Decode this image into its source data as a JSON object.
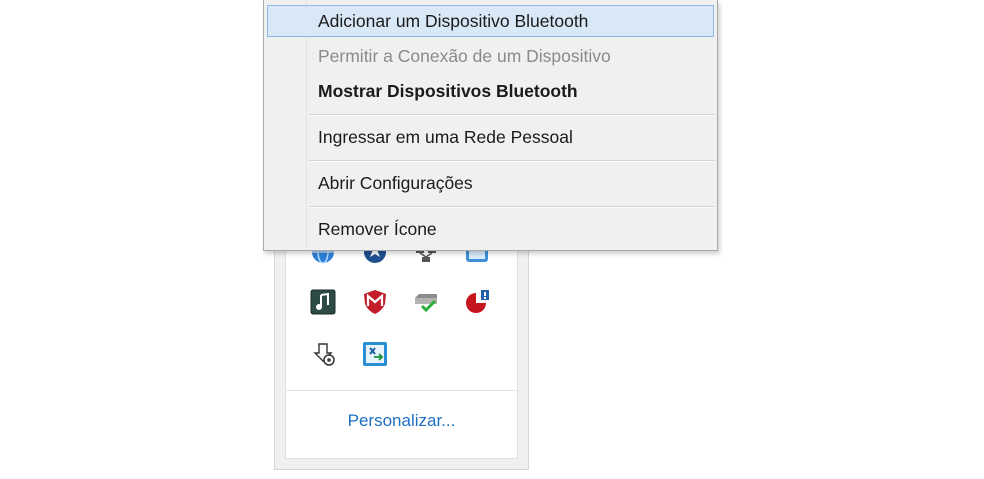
{
  "menu": {
    "items": [
      {
        "label": "Adicionar um Dispositivo Bluetooth",
        "state": "highlighted"
      },
      {
        "label": "Permitir a Conexão de um Dispositivo",
        "state": "disabled"
      },
      {
        "label": "Mostrar Dispositivos Bluetooth",
        "state": "default"
      },
      {
        "label": "Ingressar em uma Rede Pessoal",
        "state": "normal"
      },
      {
        "label": "Abrir Configurações",
        "state": "normal"
      },
      {
        "label": "Remover Ícone",
        "state": "normal"
      }
    ]
  },
  "tray": {
    "icons": [
      {
        "name": "blue-globe-icon"
      },
      {
        "name": "navigation-compass-icon"
      },
      {
        "name": "network-icon"
      },
      {
        "name": "blue-window-icon"
      },
      {
        "name": "music-player-icon"
      },
      {
        "name": "mcafee-shield-icon"
      },
      {
        "name": "drive-check-icon"
      },
      {
        "name": "red-alert-chart-icon"
      },
      {
        "name": "download-settings-icon"
      },
      {
        "name": "excel-sync-icon"
      }
    ],
    "customize_link": "Personalizar..."
  },
  "colors": {
    "menu_background": "#f0f0f0",
    "highlight_fill": "#d9e8f7",
    "highlight_border": "#8fb8e6",
    "link": "#1e6fc3",
    "disabled_text": "#8a8a8a"
  }
}
